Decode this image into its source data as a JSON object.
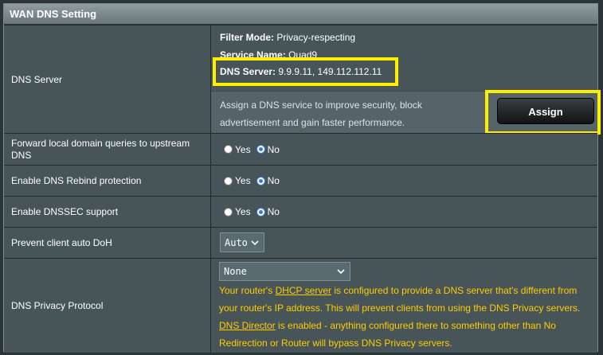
{
  "title": "WAN DNS Setting",
  "dns_server": {
    "label": "DNS Server",
    "filter_mode_key": "Filter Mode:",
    "filter_mode_value": "Privacy-respecting",
    "service_name_key": "Service Name:",
    "service_name_value": "Quad9",
    "server_key": "DNS Server:",
    "server_value": "9.9.9.11, 149.112.112.11",
    "desc_line1": "Assign a DNS service to improve security, block",
    "desc_line2": "advertisement and gain faster performance.",
    "assign_label": "Assign"
  },
  "forward_local": {
    "label_line1": "Forward local domain queries to upstream",
    "label_line2": "DNS",
    "yes_label": "Yes",
    "no_label": "No",
    "selected": "No"
  },
  "rebind": {
    "label": "Enable DNS Rebind protection",
    "yes_label": "Yes",
    "no_label": "No",
    "selected": "No"
  },
  "dnssec": {
    "label": "Enable DNSSEC support",
    "yes_label": "Yes",
    "no_label": "No",
    "selected": "No"
  },
  "doh": {
    "label": "Prevent client auto DoH",
    "value": "Auto"
  },
  "privacy": {
    "label": "DNS Privacy Protocol",
    "value": "None",
    "w1_pre": "Your router's ",
    "w1_link": "DHCP server",
    "w1_post": " is configured to provide a DNS server that's different from",
    "w2": "your router's IP address. This will prevent clients from using the DNS Privacy servers.",
    "w3_link": "DNS Director",
    "w3_post": " is enabled - anything configured there to something other than No",
    "w4": "Redirection or Router will bypass DNS Privacy servers."
  },
  "colors": {
    "highlight": "#ffee00",
    "warning": "#ffcc00",
    "radio_on": "#3b7bd7"
  }
}
